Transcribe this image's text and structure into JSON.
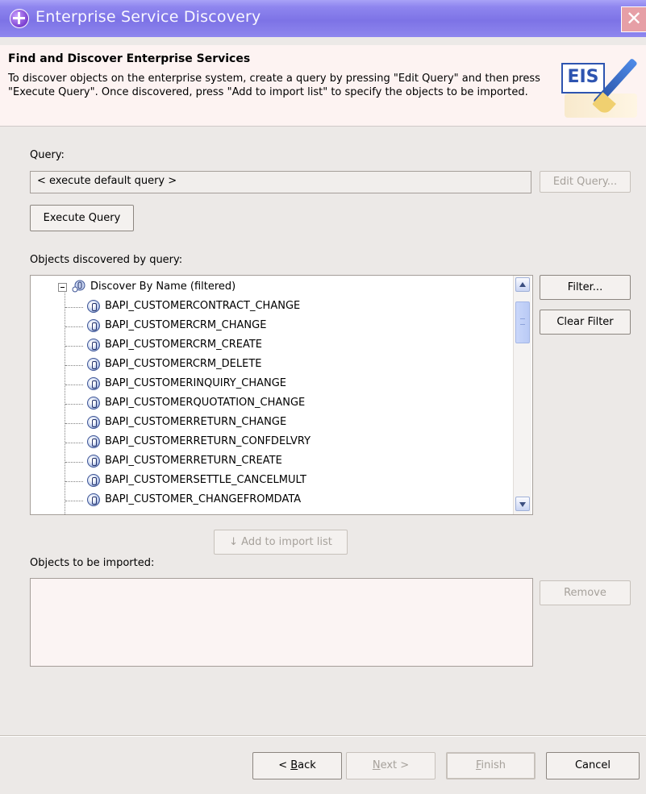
{
  "window": {
    "title": "Enterprise Service Discovery",
    "close_glyph": "✕"
  },
  "banner": {
    "title": "Find and Discover Enterprise Services",
    "description": "To discover objects on the enterprise system, create a query by pressing \"Edit Query\" and then press \"Execute Query\". Once discovered, press \"Add to import list\" to specify the objects to be imported.",
    "logo_text": "EIS"
  },
  "query": {
    "label": "Query:",
    "value": "< execute default query >",
    "edit_button": "Edit Query...",
    "execute_button": "Execute Query"
  },
  "discovered": {
    "label": "Objects discovered by query:",
    "root": "Discover By Name (filtered)",
    "items": [
      "BAPI_CUSTOMERCONTRACT_CHANGE",
      "BAPI_CUSTOMERCRM_CHANGE",
      "BAPI_CUSTOMERCRM_CREATE",
      "BAPI_CUSTOMERCRM_DELETE",
      "BAPI_CUSTOMERINQUIRY_CHANGE",
      "BAPI_CUSTOMERQUOTATION_CHANGE",
      "BAPI_CUSTOMERRETURN_CHANGE",
      "BAPI_CUSTOMERRETURN_CONFDELVRY",
      "BAPI_CUSTOMERRETURN_CREATE",
      "BAPI_CUSTOMERSETTLE_CANCELMULT",
      "BAPI_CUSTOMER_CHANGEFROMDATA"
    ],
    "filter_button": "Filter...",
    "clear_filter_button": "Clear Filter",
    "add_button": "↓ Add to import list"
  },
  "import": {
    "label": "Objects to be imported:",
    "remove_button": "Remove"
  },
  "footer": {
    "back": {
      "mnemonic": "B",
      "rest": "ack",
      "prefix": "< "
    },
    "next": {
      "mnemonic": "N",
      "rest": "ext >"
    },
    "finish": {
      "mnemonic": "F",
      "rest": "inish"
    },
    "cancel": "Cancel"
  },
  "colors": {
    "titlebar": "#8f86ef",
    "banner": "#fdf3f2",
    "dialog": "#ece9e7",
    "disabled_text": "#a6a19b"
  }
}
